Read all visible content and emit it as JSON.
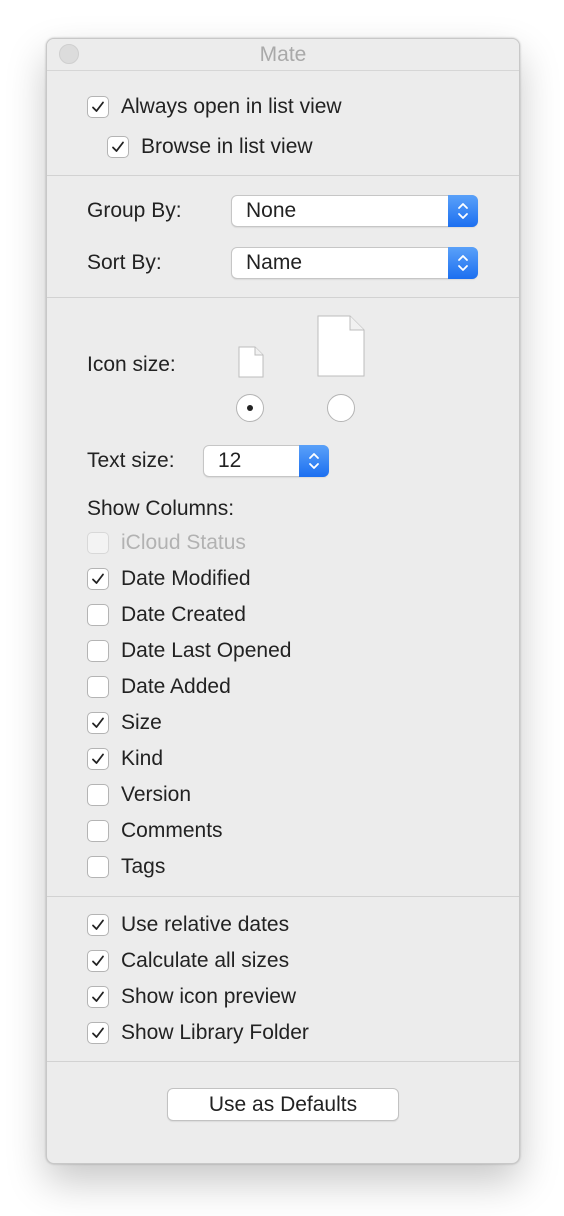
{
  "window": {
    "title": "Mate"
  },
  "top_options": [
    {
      "label": "Always open in list view",
      "checked": true
    },
    {
      "label": "Browse in list view",
      "checked": true
    }
  ],
  "group_by": {
    "label": "Group By:",
    "value": "None"
  },
  "sort_by": {
    "label": "Sort By:",
    "value": "Name"
  },
  "icon_size": {
    "label": "Icon size:",
    "selected": "small"
  },
  "text_size": {
    "label": "Text size:",
    "value": "12"
  },
  "show_columns": {
    "label": "Show Columns:",
    "items": [
      {
        "label": "iCloud Status",
        "checked": false,
        "disabled": true
      },
      {
        "label": "Date Modified",
        "checked": true,
        "disabled": false
      },
      {
        "label": "Date Created",
        "checked": false,
        "disabled": false
      },
      {
        "label": "Date Last Opened",
        "checked": false,
        "disabled": false
      },
      {
        "label": "Date Added",
        "checked": false,
        "disabled": false
      },
      {
        "label": "Size",
        "checked": true,
        "disabled": false
      },
      {
        "label": "Kind",
        "checked": true,
        "disabled": false
      },
      {
        "label": "Version",
        "checked": false,
        "disabled": false
      },
      {
        "label": "Comments",
        "checked": false,
        "disabled": false
      },
      {
        "label": "Tags",
        "checked": false,
        "disabled": false
      }
    ]
  },
  "bottom_options": [
    {
      "label": "Use relative dates",
      "checked": true
    },
    {
      "label": "Calculate all sizes",
      "checked": true
    },
    {
      "label": "Show icon preview",
      "checked": true
    },
    {
      "label": "Show Library Folder",
      "checked": true
    }
  ],
  "defaults_button": {
    "label": "Use as Defaults"
  },
  "colors": {
    "accent": "#1c6ff0",
    "window_bg": "#ececec"
  }
}
